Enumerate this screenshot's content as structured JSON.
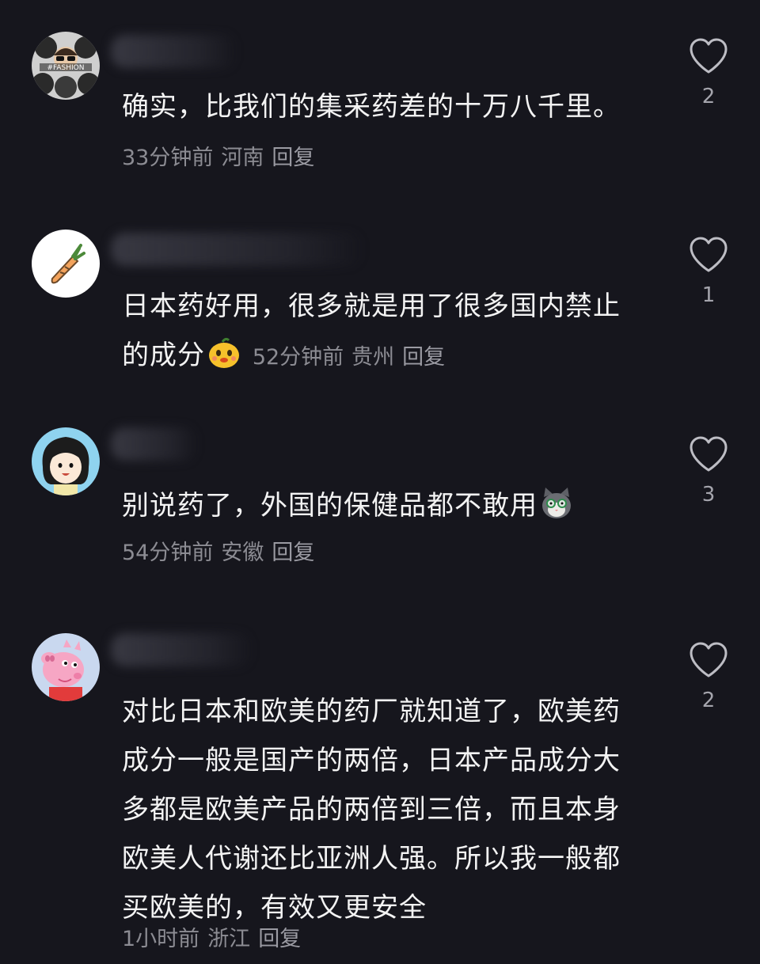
{
  "comments": [
    {
      "text": "确实，比我们的集采药差的十万八千里。",
      "time": "33分钟前",
      "location": "河南",
      "reply_label": "回复",
      "likes": "2",
      "avatar_text": "#FASHION"
    },
    {
      "text": "日本药好用，很多就是用了很多国内禁止的成分",
      "time": "52分钟前",
      "location": "贵州",
      "reply_label": "回复",
      "likes": "1",
      "emoji": "smiling-orange-emoji"
    },
    {
      "text": "别说药了，外国的保健品都不敢用",
      "time": "54分钟前",
      "location": "安徽",
      "reply_label": "回复",
      "likes": "3",
      "emoji": "grey-cat-emoji"
    },
    {
      "text": "对比日本和欧美的药厂就知道了，欧美药成分一般是国产的两倍，日本产品成分大多都是欧美产品的两倍到三倍，而且本身欧美人代谢还比亚洲人强。所以我一般都买欧美的，有效又更安全",
      "time": "1小时前",
      "location": "浙江",
      "reply_label": "回复",
      "likes": "2"
    }
  ],
  "icons": {
    "like": "heart-outline-icon"
  },
  "colors": {
    "background": "#16161d",
    "meta_text": "#8c8c93",
    "body_text": "#f3f3f3"
  }
}
